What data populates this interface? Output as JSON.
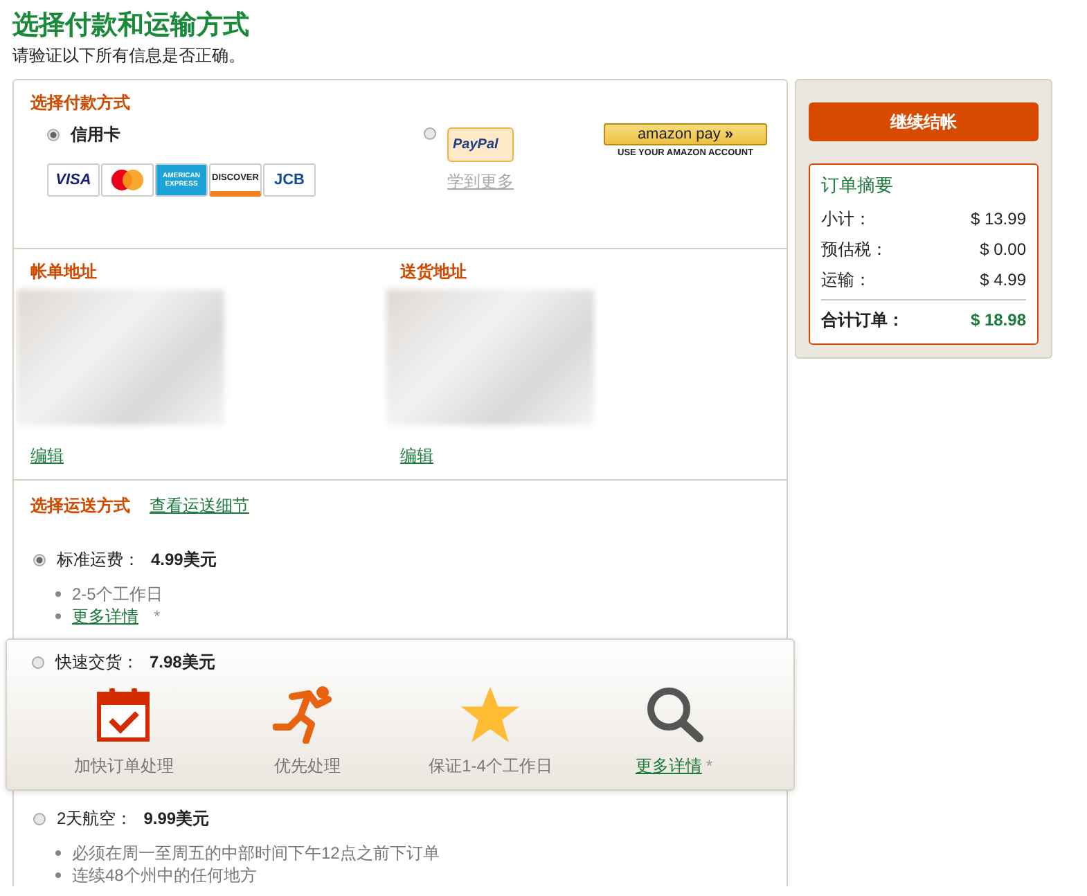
{
  "page": {
    "title": "选择付款和运输方式",
    "subtitle": "请验证以下所有信息是否正确。"
  },
  "payment": {
    "heading": "选择付款方式",
    "methods": [
      {
        "kind": "card",
        "selected": true,
        "label": "信用卡",
        "cards": [
          {
            "kind": "visa",
            "label": "VISA"
          },
          {
            "kind": "mastercard"
          },
          {
            "kind": "amex",
            "label": "AMERICAN EXPRESS"
          },
          {
            "kind": "discover",
            "label": "DISCOVER"
          },
          {
            "kind": "jcb",
            "label": "JCB"
          }
        ]
      },
      {
        "kind": "paypal",
        "selected": false,
        "logo": "PayPal",
        "link": "学到更多"
      },
      {
        "kind": "amazon",
        "logo": "amazon pay",
        "arrow": "»",
        "caption": "USE YOUR AMAZON ACCOUNT"
      }
    ]
  },
  "addresses": [
    {
      "heading": "帐单地址",
      "edit": "编辑"
    },
    {
      "heading": "送货地址",
      "edit": "编辑"
    }
  ],
  "shipping": {
    "heading": "选择运送方式",
    "details_link": "查看运送细节",
    "options": [
      {
        "kind": "bullets",
        "selected": true,
        "highlighted": false,
        "label": "标准运费：",
        "price": "4.99美元",
        "bullets": [
          {
            "kind": "text",
            "text": "2-5个工作日"
          },
          {
            "kind": "link",
            "text": "更多详情",
            "note": "*"
          }
        ]
      },
      {
        "kind": "features",
        "selected": false,
        "highlighted": true,
        "label": "快速交货：",
        "price": "7.98美元",
        "features": [
          {
            "kind": "text",
            "text": "加快订单处理"
          },
          {
            "kind": "text",
            "text": "优先处理"
          },
          {
            "kind": "text",
            "text": "保证1-4个工作日"
          },
          {
            "kind": "link",
            "text": "更多详情",
            "note": "*"
          }
        ]
      },
      {
        "kind": "bullets",
        "selected": false,
        "highlighted": false,
        "label": "2天航空：",
        "price": "9.99美元",
        "bullets": [
          {
            "kind": "text",
            "text": "必须在周一至周五的中部时间下午12点之前下订单"
          },
          {
            "kind": "text",
            "text": "连续48个州中的任何地方"
          }
        ]
      }
    ]
  },
  "sidebar": {
    "button": "继续结帐",
    "summary": {
      "title": "订单摘要",
      "rows": [
        {
          "label": "小计：",
          "value": "$ 13.99"
        },
        {
          "label": "预估税：",
          "value": "$ 0.00"
        },
        {
          "label": "运输：",
          "value": "$ 4.99"
        }
      ],
      "total": {
        "label": "合计订单：",
        "value": "$ 18.98"
      }
    }
  }
}
